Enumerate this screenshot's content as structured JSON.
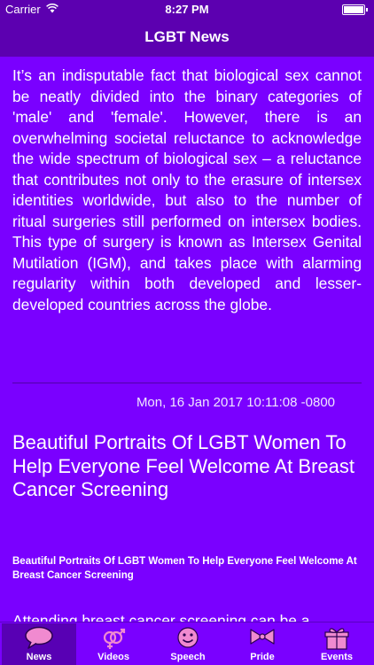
{
  "status_bar": {
    "carrier": "Carrier",
    "time": "8:27 PM",
    "battery_level": 0.9
  },
  "nav": {
    "title": "LGBT News"
  },
  "article": {
    "summary": "It’s an indisputable fact that biological sex cannot be neatly divided into the binary categories of 'male' and 'female'. However, there is an overwhelming societal reluctance to acknowledge the wide spectrum of biological sex – a reluctance that contributes not only to the erasure of intersex identities worldwide, but also to the number of ritual surgeries still performed on intersex bodies. This type of surgery is known as Intersex Genital Mutilation (IGM), and takes place with alarming regularity within both developed and lesser-developed countries across the globe.",
    "date": "Mon, 16 Jan 2017 10:11:08 -0800"
  },
  "next_article": {
    "headline": "Beautiful Portraits Of LGBT Women To Help Everyone Feel Welcome At Breast Cancer Screening",
    "subheadline": "Beautiful Portraits Of LGBT Women To Help Everyone Feel Welcome At Breast Cancer Screening",
    "teaser": "Attending breast cancer screening can be a"
  },
  "tabs": [
    {
      "label": "News",
      "icon": "speech-bubble-icon",
      "active": true
    },
    {
      "label": "Videos",
      "icon": "gender-symbols-icon",
      "active": false
    },
    {
      "label": "Speech",
      "icon": "smiley-face-icon",
      "active": false
    },
    {
      "label": "Pride",
      "icon": "bow-ribbon-icon",
      "active": false
    },
    {
      "label": "Events",
      "icon": "gift-box-icon",
      "active": false
    }
  ],
  "colors": {
    "background": "#7a00ff",
    "bar": "#5c00b0",
    "active_tab": "#5800b4",
    "text": "#ffffff"
  }
}
